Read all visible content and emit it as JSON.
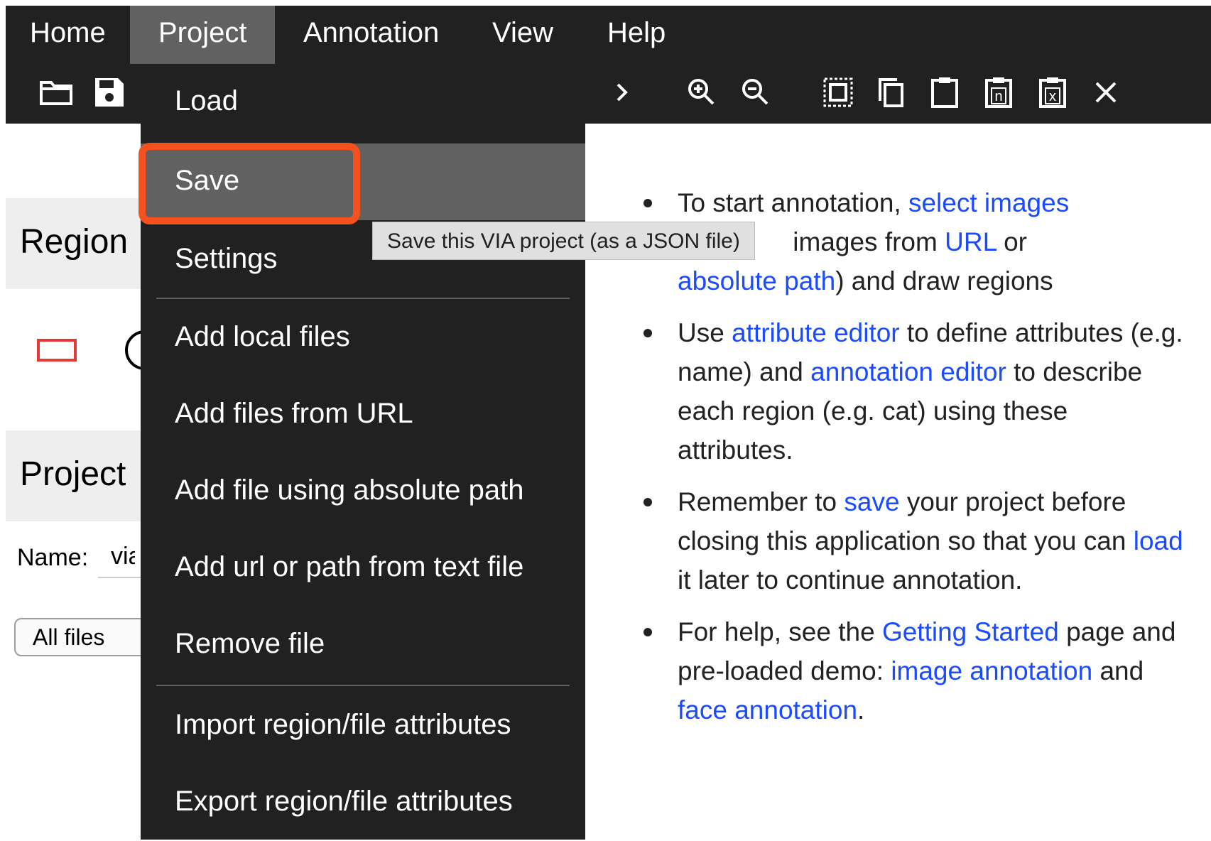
{
  "menu": {
    "items": [
      "Home",
      "Project",
      "Annotation",
      "View",
      "Help"
    ],
    "active": "Project"
  },
  "toolbar": {
    "icons": [
      "folder-open-icon",
      "save-disk-icon",
      "chevron-right-icon",
      "zoom-in-icon",
      "zoom-out-icon",
      "select-all-icon",
      "copy-icon",
      "paste-icon",
      "paste-n-icon",
      "paste-delete-icon",
      "close-icon"
    ],
    "paste_n_glyph": "n",
    "paste_x_glyph": "x"
  },
  "left_panel": {
    "region_heading": "Region",
    "project_heading": "Project",
    "name_label": "Name:",
    "name_value": "via",
    "files_filter": "All files"
  },
  "dropdown": {
    "items": [
      "Load",
      "Save",
      "Settings",
      "Add local files",
      "Add files from URL",
      "Add file using absolute path",
      "Add url or path from text file",
      "Remove file",
      "Import region/file attributes",
      "Export region/file attributes"
    ],
    "hovered": "Save"
  },
  "tooltip": "Save this VIA project (as a JSON file)",
  "info": {
    "b1_pre": "To start annotation,",
    "b1_link1": "select images",
    "b1_mid": "images from",
    "b1_link2": "URL",
    "b1_or": "or",
    "b1_link3": "absolute path",
    "b1_post": ") and draw regions",
    "b2_pre": "Use",
    "b2_link1": "attribute editor",
    "b2_mid": "to define attributes (e.g. name) and",
    "b2_link2": "annotation editor",
    "b2_post": "to describe each region (e.g. cat) using these attributes.",
    "b3_pre": "Remember to",
    "b3_link1": "save",
    "b3_mid": "your project before closing this application so that you can",
    "b3_link2": "load",
    "b3_post": "it later to continue annotation.",
    "b4_pre": "For help, see the",
    "b4_link1": "Getting Started",
    "b4_mid": "page and pre-loaded demo:",
    "b4_link2": "image annotation",
    "b4_and": "and",
    "b4_link3": "face annotation",
    "b4_post": "."
  },
  "colors": {
    "bar": "#212121",
    "hover": "#616161",
    "highlight": "#f4511e",
    "link": "#1a4bff",
    "rect_shape": "#e53935"
  }
}
